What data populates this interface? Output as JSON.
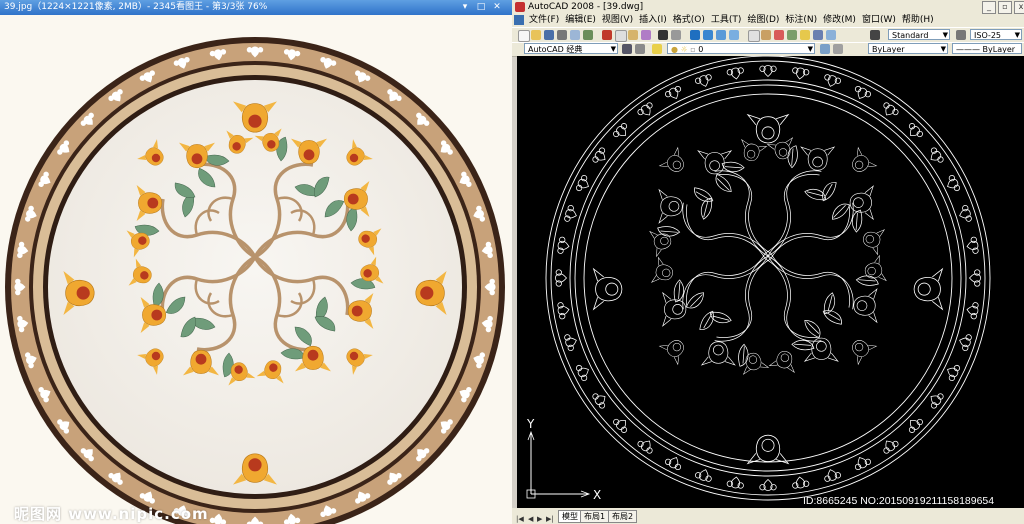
{
  "viewer": {
    "title": "39.jpg（1224×1221像素, 2MB）- 2345看图王 - 第3/3张 76%",
    "controls": {
      "minimize": "▾",
      "maximize": "□",
      "close": "✕"
    },
    "watermark": "昵图网 www.nipic.com"
  },
  "cad": {
    "title": "AutoCAD 2008 - [39.dwg]",
    "menu": [
      "文件(F)",
      "编辑(E)",
      "视图(V)",
      "插入(I)",
      "格式(O)",
      "工具(T)",
      "绘图(D)",
      "标注(N)",
      "修改(M)",
      "窗口(W)",
      "帮助(H)"
    ],
    "text_style": "Standard",
    "dim_style": "ISO-25",
    "workspace": "AutoCAD 经典",
    "layer": "0",
    "color": "ByLayer",
    "linetype": "ByLayer",
    "ucs_x": "X",
    "ucs_y": "Y",
    "tabs": [
      "模型",
      "布局1",
      "布局2"
    ],
    "active_tab_index": 0
  },
  "watermark_id": "ID:8665245 NO:20150919211158189654",
  "colors": {
    "cream": "#fbf8f0",
    "marble_light": "#f4f1ec",
    "band_brown": "#3b2418",
    "band_tan": "#c8a27a",
    "flower_orange": "#f0a830",
    "flower_red": "#b83a1e",
    "leaf_green": "#6f9c7a",
    "vine_tan": "#b8936c",
    "cad_bg": "#000000",
    "cad_line": "#ffffff"
  }
}
